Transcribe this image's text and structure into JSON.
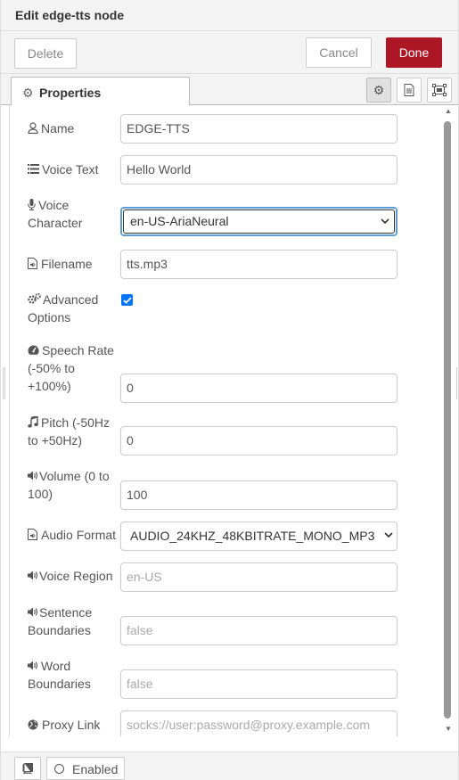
{
  "header": {
    "title": "Edit edge-tts node"
  },
  "toolbar": {
    "delete_label": "Delete",
    "cancel_label": "Cancel",
    "done_label": "Done"
  },
  "tabs": {
    "properties_label": "Properties"
  },
  "form": {
    "name": {
      "label": "Name",
      "value": "EDGE-TTS"
    },
    "voice_text": {
      "label": "Voice Text",
      "value": "Hello World"
    },
    "voice_character": {
      "label_line1": "Voice",
      "label_line2": "Character",
      "value": "en-US-AriaNeural"
    },
    "filename": {
      "label": "Filename",
      "value": "tts.mp3"
    },
    "advanced": {
      "label_line1": "Advanced",
      "label_line2": "Options",
      "checked": true
    },
    "speech_rate": {
      "label_line1": "Speech Rate",
      "label_line2": "(-50% to",
      "label_line3": "+100%)",
      "value": "0"
    },
    "pitch": {
      "label_line1": "Pitch (-50Hz",
      "label_line2": "to +50Hz)",
      "value": "0"
    },
    "volume": {
      "label_line1": "Volume (0 to",
      "label_line2": "100)",
      "value": "100"
    },
    "audio_format": {
      "label": "Audio Format",
      "value": "AUDIO_24KHZ_48KBITRATE_MONO_MP3"
    },
    "voice_region": {
      "label": "Voice Region",
      "placeholder": "en-US"
    },
    "sentence_boundaries": {
      "label_line1": "Sentence",
      "label_line2": "Boundaries",
      "placeholder": "false"
    },
    "word_boundaries": {
      "label_line1": "Word",
      "label_line2": "Boundaries",
      "placeholder": "false"
    },
    "proxy_link": {
      "label": "Proxy Link",
      "placeholder": "socks://user:password@proxy.example.com"
    }
  },
  "footer": {
    "enabled_label": "Enabled"
  },
  "colors": {
    "done_button": "#ad1625",
    "checkbox": "#0075ff",
    "focus_border": "#5b9dd9"
  }
}
